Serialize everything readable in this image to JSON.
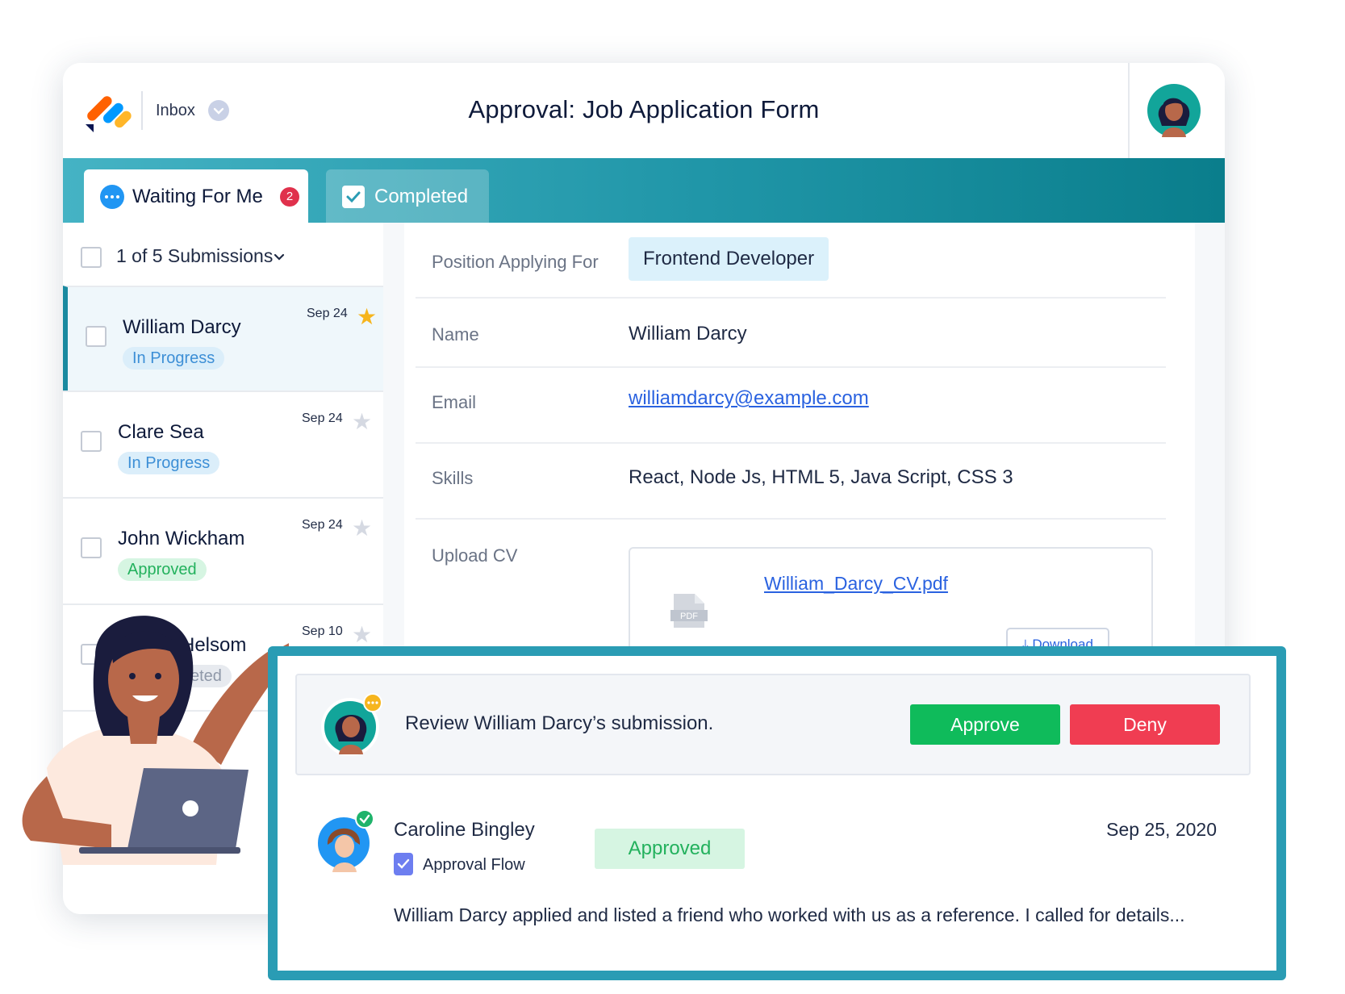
{
  "header": {
    "inbox_label": "Inbox",
    "page_title": "Approval:  Job Application Form"
  },
  "tabs": [
    {
      "label": "Waiting For Me",
      "badge": "2",
      "active": true
    },
    {
      "label": "Completed",
      "active": false
    }
  ],
  "list": {
    "header": "1 of 5 Submissions",
    "items": [
      {
        "name": "William Darcy",
        "date": "Sep 24",
        "status": "In Progress",
        "starred": true
      },
      {
        "name": "Clare Sea",
        "date": "Sep 24",
        "status": "In Progress",
        "starred": false
      },
      {
        "name": "John Wickham",
        "date": "Sep 24",
        "status": "Approved",
        "starred": false
      },
      {
        "name": "Helsom",
        "date": "Sep 10",
        "status": "eted",
        "starred": false
      }
    ]
  },
  "detail": {
    "position_label": "Position Applying For",
    "position_value": "Frontend Developer",
    "name_label": "Name",
    "name_value": "William Darcy",
    "email_label": "Email",
    "email_value": "williamdarcy@example.com",
    "skills_label": "Skills",
    "skills_value": "React, Node Js, HTML 5, Java Script, CSS 3",
    "cv_label": "Upload CV",
    "cv_file": "William_Darcy_CV.pdf",
    "cv_icon_text": "PDF",
    "download_label": "Download"
  },
  "review": {
    "text": "Review William Darcy’s submission.",
    "approve_label": "Approve",
    "deny_label": "Deny"
  },
  "history": {
    "name": "Caroline Bingley",
    "flow": "Approval Flow",
    "status": "Approved",
    "date": "Sep 25, 2020",
    "comment": "William Darcy applied and listed a friend who worked with us as a reference. I called for details..."
  },
  "colors": {
    "brand_teal": "#2a9cb4",
    "approve_green": "#0fbb5b",
    "deny_red": "#f03d52",
    "link_blue": "#2a62e0",
    "star_gold": "#f6b51d"
  },
  "icons": [
    "app-logo",
    "chevron-down-icon",
    "dots-icon",
    "check-icon",
    "star-icon",
    "pdf-icon",
    "download-icon",
    "verified-check-icon",
    "approval-flow-icon"
  ]
}
